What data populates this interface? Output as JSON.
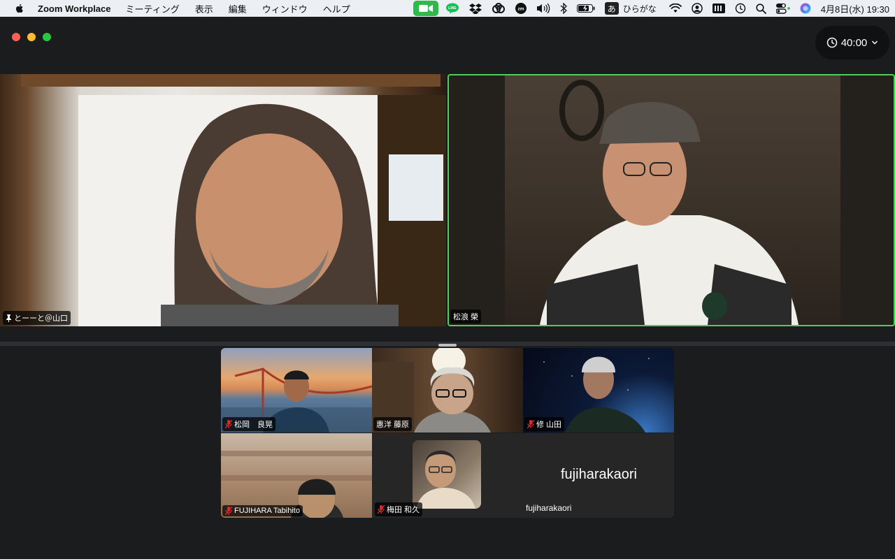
{
  "menubar": {
    "app_name": "Zoom Workplace",
    "items": [
      "ミーティング",
      "表示",
      "編集",
      "ウィンドウ",
      "ヘルプ"
    ],
    "ime_char": "あ",
    "ime_label": "ひらがな",
    "datetime": "4月8日(水)  19:30"
  },
  "window": {
    "timer": "40:00"
  },
  "speakers": [
    {
      "name": "とーーと＠山口",
      "pinned": true
    },
    {
      "name": "松浪 榮",
      "active": true
    }
  ],
  "gallery": [
    {
      "name": "松岡　良晃",
      "muted": true
    },
    {
      "name": "惠洋 藤原",
      "muted": false
    },
    {
      "name": "修 山田",
      "muted": true
    },
    {
      "name": "FUJIHARA Tabihito",
      "muted": true
    },
    {
      "name": "梅田 和久",
      "muted": true
    },
    {
      "name": "fujiharakaori",
      "display_name": "fujiharakaori",
      "muted": false
    }
  ],
  "colors": {
    "active_speaker_border": "#4fce5d",
    "zoom_tray": "#2fb94a",
    "mute_icon": "#e02828"
  }
}
